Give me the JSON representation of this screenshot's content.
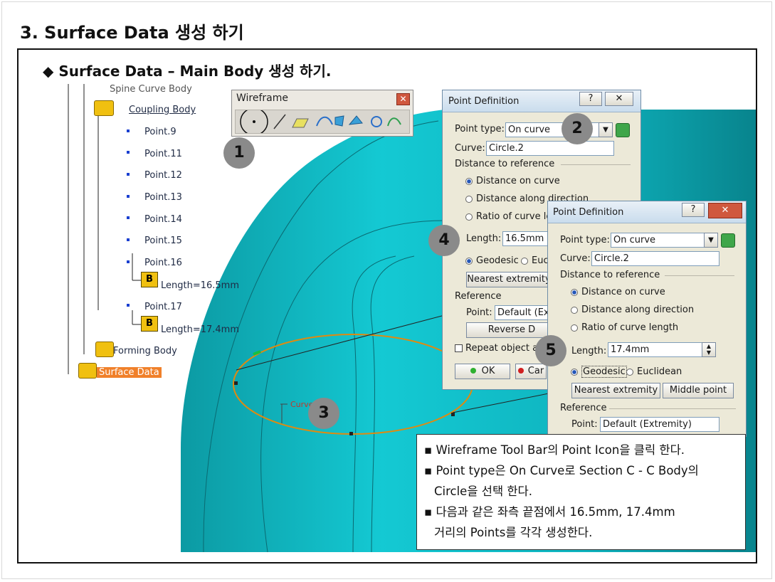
{
  "page": {
    "title": "3. Surface Data 생성 하기",
    "subtitle_bullet": "◆",
    "subtitle": "Surface Data – Main Body 생성 하기."
  },
  "tree": {
    "partial_top": "Spine Curve Body",
    "coupling": "Coupling Body",
    "points": [
      "Point.9",
      "Point.11",
      "Point.12",
      "Point.13",
      "Point.14",
      "Point.15",
      "Point.16"
    ],
    "param16": "Length=16.5mm",
    "point17": "Point.17",
    "param17": "Length=17.4mm",
    "forming": "Forming Body",
    "surface": "Surface Data"
  },
  "wireframe": {
    "title": "Wireframe",
    "close": "✕"
  },
  "canvas": {
    "curve_label": "Curve"
  },
  "dialog1": {
    "title": "Point Definition",
    "help": "?",
    "close": "✕",
    "point_type_label": "Point type:",
    "point_type_value": "On curve",
    "curve_label": "Curve:",
    "curve_value": "Circle.2",
    "distance_header": "Distance to reference",
    "opt1": "Distance on curve",
    "opt2": "Distance along direction",
    "opt3": "Ratio of curve le",
    "length_label": "Length:",
    "length_value": "16.5mm",
    "geodesic": "Geodesic",
    "euclid": "Euc",
    "nearest": "Nearest extremity",
    "reference_header": "Reference",
    "point_label": "Point:",
    "point_value": "Default (Ext",
    "reverse": "Reverse D",
    "repeat": "Repeat object af",
    "ok": "OK",
    "cancel": "Car"
  },
  "dialog2": {
    "title": "Point Definition",
    "help": "?",
    "close": "✕",
    "point_type_label": "Point type:",
    "point_type_value": "On curve",
    "curve_label": "Curve:",
    "curve_value": "Circle.2",
    "distance_header": "Distance to reference",
    "opt1": "Distance on curve",
    "opt2": "Distance along direction",
    "opt3": "Ratio of curve length",
    "length_label": "Length:",
    "length_value": "17.4mm",
    "geodesic": "Geodesic",
    "euclidean": "Euclidean",
    "nearest": "Nearest extremity",
    "middle": "Middle point",
    "reference_header": "Reference",
    "point_label": "Point:",
    "point_value": "Default (Extremity)"
  },
  "badges": [
    "1",
    "2",
    "3",
    "4",
    "5"
  ],
  "notes": {
    "bullet": "▪",
    "line1": "Wireframe Tool Bar의 Point Icon을 클릭 한다.",
    "line2a": "Point type은 On Curve로 Section C - C Body의",
    "line2b": "Circle을 선택 한다.",
    "line3a": "다음과 같은 좌측 끝점에서 16.5mm, 17.4mm",
    "line3b": "거리의 Points를 각각 생성한다."
  },
  "colors": {
    "surface": "#12c2cc",
    "surface_dark": "#0a8f99",
    "surface_selected": "#f0802a",
    "badge": "#8a8a8a",
    "curve": "#e08a10"
  }
}
